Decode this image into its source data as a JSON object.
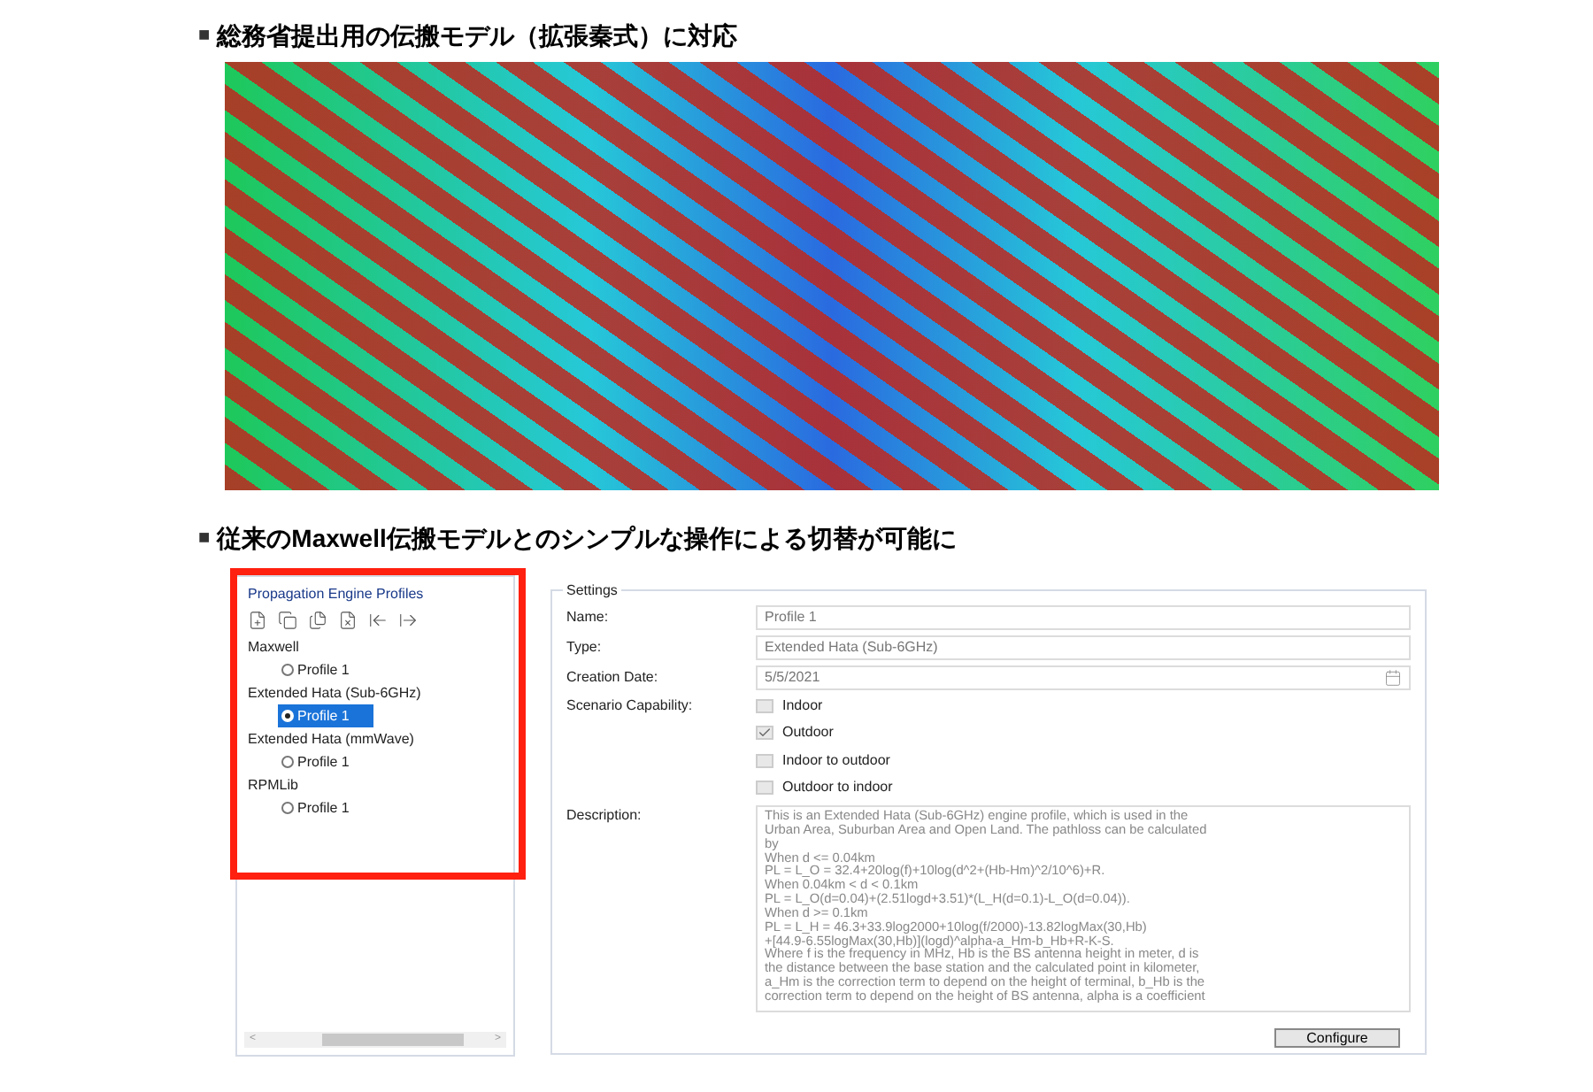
{
  "headings": [
    {
      "bullet": "■",
      "text": "総務省提出用の伝搬モデル（拡張秦式）に対応"
    },
    {
      "bullet": "■",
      "text": "従来のMaxwell伝搬モデルとのシンプルな操作による切替が可能に"
    }
  ],
  "profiles_panel": {
    "title": "Propagation Engine Profiles",
    "highlighted": true,
    "groups": [
      {
        "name": "Maxwell",
        "profiles": [
          {
            "label": "Profile 1",
            "selected": false
          }
        ]
      },
      {
        "name": "Extended Hata (Sub-6GHz)",
        "profiles": [
          {
            "label": "Profile 1",
            "selected": true
          }
        ]
      },
      {
        "name": "Extended Hata (mmWave)",
        "profiles": [
          {
            "label": "Profile 1",
            "selected": false
          }
        ]
      },
      {
        "name": "RPMLib",
        "profiles": [
          {
            "label": "Profile 1",
            "selected": false
          }
        ]
      }
    ],
    "scroll_left": "<",
    "scroll_right": ">"
  },
  "settings": {
    "title": "Settings",
    "fields": [
      {
        "label": "Name:",
        "value": "Profile 1",
        "kind": "text"
      },
      {
        "label": "Type:",
        "value": "Extended Hata (Sub-6GHz)",
        "kind": "text"
      },
      {
        "label": "Creation Date:",
        "value": "5/5/2021",
        "kind": "date"
      }
    ],
    "capability_label": "Scenario Capability:",
    "capabilities": [
      {
        "label": "Indoor",
        "checked": false
      },
      {
        "label": "Outdoor",
        "checked": true
      },
      {
        "label": "Indoor to outdoor",
        "checked": false
      },
      {
        "label": "Outdoor to indoor",
        "checked": false
      }
    ],
    "description_label": "Description:",
    "description_lines": [
      "This is an Extended Hata (Sub-6GHz) engine profile, which is used in the",
      "Urban Area, Suburban Area and Open Land. The pathloss can be calculated",
      "by",
      "When d <= 0.04km",
      "PL = L_O = 32.4+20log(f)+10log(d^2+(Hb-Hm)^2/10^6)+R.",
      "When 0.04km < d < 0.1km",
      "PL = L_O(d=0.04)+(2.51logd+3.51)*(L_H(d=0.1)-L_O(d=0.04)).",
      "When d >= 0.1km",
      "PL = L_H = 46.3+33.9log2000+10log(f/2000)-13.82logMax(30,Hb)",
      "+[44.9-6.55logMax(30,Hb)](logd)^alpha-a_Hm-b_Hb+R-K-S.",
      "Where f is the frequency in MHz, Hb is the BS antenna height in meter, d is",
      "the distance between the base station and the calculated point in kilometer,",
      "a_Hm is the correction term to depend on the height of terminal, b_Hb is the",
      "correction term to depend on the height of BS antenna, alpha is a coefficient"
    ],
    "button": "Configure"
  }
}
